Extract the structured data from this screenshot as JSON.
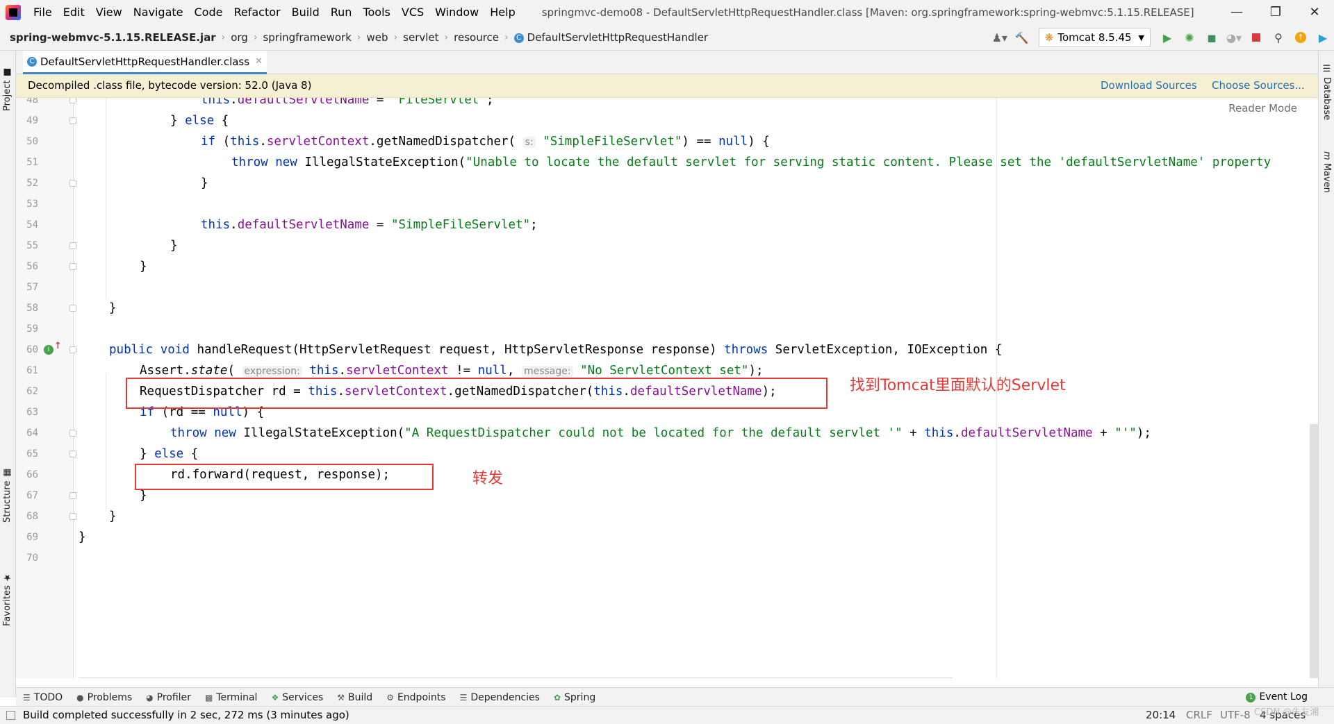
{
  "menu": {
    "items": [
      "File",
      "Edit",
      "View",
      "Navigate",
      "Code",
      "Refactor",
      "Build",
      "Run",
      "Tools",
      "VCS",
      "Window",
      "Help"
    ],
    "window_title": "springmvc-demo08 - DefaultServletHttpRequestHandler.class [Maven: org.springframework:spring-webmvc:5.1.15.RELEASE]"
  },
  "breadcrumb": {
    "jar": "spring-webmvc-5.1.15.RELEASE.jar",
    "items": [
      "org",
      "springframework",
      "web",
      "servlet",
      "resource"
    ],
    "class_name": "DefaultServletHttpRequestHandler"
  },
  "run_config": {
    "label": "Tomcat 8.5.45"
  },
  "tab": {
    "label": "DefaultServletHttpRequestHandler.class"
  },
  "banner": {
    "message": "Decompiled .class file, bytecode version: 52.0 (Java 8)",
    "download_sources": "Download Sources",
    "choose_sources": "Choose Sources..."
  },
  "editor": {
    "reader_mode": "Reader Mode"
  },
  "side_tabs": {
    "project": "Project",
    "structure": "Structure",
    "favorites": "Favorites",
    "database": "Database",
    "maven": "Maven"
  },
  "code": {
    "line_numbers": [
      "48",
      "49",
      "50",
      "51",
      "52",
      "53",
      "54",
      "55",
      "56",
      "57",
      "58",
      "59",
      "60",
      "61",
      "62",
      "63",
      "64",
      "65",
      "66",
      "67",
      "68",
      "69",
      "70"
    ],
    "l48_kw": "this",
    "l48_fld": "defaultServletName",
    "l48_eq": " = ",
    "l48_str": "\"FileServlet\"",
    "l48_end": ";",
    "l49_brace": "} ",
    "l49_kw": "else",
    "l49_end": " {",
    "l50_if": "if",
    "l50_a": " (",
    "l50_this": "this",
    "l50_dot": ".",
    "l50_fld": "servletContext",
    "l50_call": ".getNamedDispatcher(",
    "l50_hint": "s:",
    "l50_str": "\"SimpleFileServlet\"",
    "l50_b": ") == ",
    "l50_null": "null",
    "l50_end": ") {",
    "l51_throw": "throw",
    "l51_new": "new",
    "l51_cls": " IllegalStateException(",
    "l51_str": "\"Unable to locate the default servlet for serving static content. Please set the 'defaultServletName' property",
    "l52": "}",
    "l54_kw": "this",
    "l54_fld": "defaultServletName",
    "l54_eq": " = ",
    "l54_str": "\"SimpleFileServlet\"",
    "l54_end": ";",
    "l55": "}",
    "l56": "}",
    "l58": "}",
    "l60_public": "public",
    "l60_void": "void",
    "l60_name": " handleRequest(HttpServletRequest request, HttpServletResponse response) ",
    "l60_throws": "throws",
    "l60_end": " ServletException, IOException {",
    "l61_a": "Assert.",
    "l61_state": "state",
    "l61_b": "(",
    "l61_hint1": "expression:",
    "l61_this": "this",
    "l61_dot": ".",
    "l61_fld": "servletContext",
    "l61_c": " != ",
    "l61_null": "null",
    "l61_d": ", ",
    "l61_hint2": "message:",
    "l61_str": "\"No ServletContext set\"",
    "l61_end": ");",
    "l62_a": "RequestDispatcher rd = ",
    "l62_this": "this",
    "l62_dot": ".",
    "l62_fld": "servletContext",
    "l62_call": ".getNamedDispatcher(",
    "l62_this2": "this",
    "l62_dot2": ".",
    "l62_fld2": "defaultServletName",
    "l62_end": ");",
    "l63_if": "if",
    "l63_a": " (rd == ",
    "l63_null": "null",
    "l63_end": ") {",
    "l64_throw": "throw",
    "l64_new": "new",
    "l64_cls": " IllegalStateException(",
    "l64_str": "\"A RequestDispatcher could not be located for the default servlet '\"",
    "l64_plus": " + ",
    "l64_this": "this",
    "l64_dot": ".",
    "l64_fld": "defaultServletName",
    "l64_plus2": " + ",
    "l64_str2": "\"'\"",
    "l64_end": ");",
    "l65_brace": "} ",
    "l65_else": "else",
    "l65_end": " {",
    "l66": "rd.forward(request, response);",
    "l67": "}",
    "l68": "}",
    "l69": "}"
  },
  "annotations": {
    "find_default_servlet": "找到Tomcat里面默认的Servlet",
    "forward": "转发"
  },
  "bottom_tabs": [
    "TODO",
    "Problems",
    "Profiler",
    "Terminal",
    "Services",
    "Build",
    "Endpoints",
    "Dependencies",
    "Spring"
  ],
  "event_log": "Event Log",
  "status": {
    "message": "Build completed successfully in 2 sec, 272 ms (3 minutes ago)",
    "position": "20:14",
    "line_sep": "CRLF",
    "encoding": "UTF-8",
    "indent": "4 spaces",
    "watermark": "CSDN @朱友湘"
  },
  "colors": {
    "keyword": "#0033b3",
    "field": "#871094",
    "string": "#067d17",
    "annotation": "#e53935",
    "banner_bg": "#f5f0d3"
  }
}
